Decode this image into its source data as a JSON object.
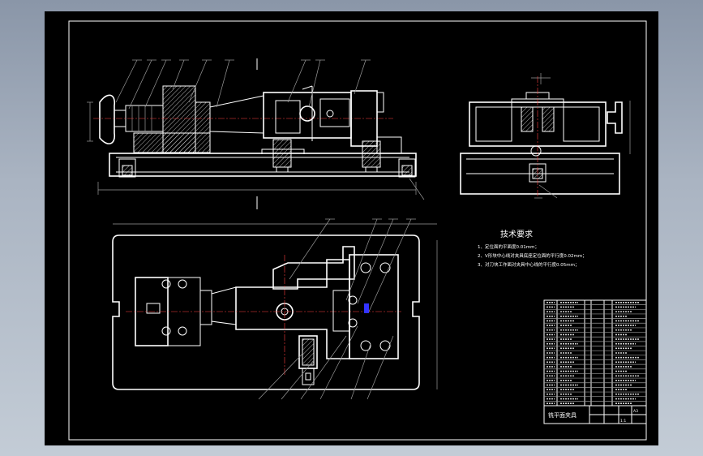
{
  "tech_requirements": {
    "title": "技术要求",
    "items": [
      "1、定位面的平面度0.01mm；",
      "2、V形块中心线对夹具底座定位面的平行度0.02mm；",
      "3、对刀块工作面对夹具中心线的平行度0.05mm；"
    ]
  },
  "title_block": {
    "drawing_name": "铣平面夹具",
    "scale": "1:1",
    "sheet_size": "A3"
  },
  "colors": {
    "background": "#000000",
    "lines": "#ffffff",
    "centerlines": "#ff4040",
    "dimensions": "#ffff00",
    "highlight": "#3333ff"
  }
}
